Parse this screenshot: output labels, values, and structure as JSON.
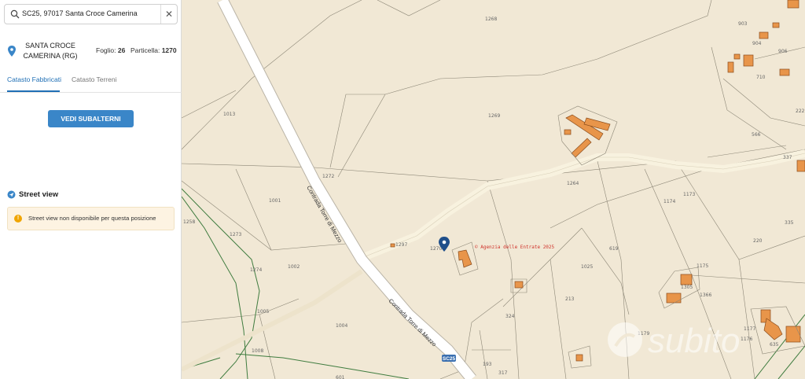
{
  "search": {
    "value": "SC25, 97017 Santa Croce Camerina",
    "search_icon": "search-icon",
    "clear_icon": "close-icon"
  },
  "location": {
    "town_line1": "SANTA CROCE",
    "town_line2": "CAMERINA (RG)",
    "foglio_label": "Foglio:",
    "foglio_value": "26",
    "particella_label": "Particella:",
    "particella_value": "1270"
  },
  "tabs": [
    {
      "label": "Catasto Fabbricati",
      "active": true
    },
    {
      "label": "Catasto Terreni",
      "active": false
    }
  ],
  "button": {
    "label": "VEDI SUBALTERNI"
  },
  "street_view": {
    "title": "Street view",
    "message": "Street view non disponibile per questa posizione"
  },
  "map": {
    "parcel_labels": [
      "1268",
      "903",
      "904",
      "906",
      "710",
      "1013",
      "1269",
      "566",
      "222",
      "1272",
      "1264",
      "337",
      "1001",
      "1173",
      "1174",
      "1258",
      "1273",
      "1297",
      "1270",
      "619",
      "220",
      "335",
      "1274",
      "1002",
      "1025",
      "1175",
      "1305",
      "1366",
      "213",
      "1005",
      "324",
      "1004",
      "1179",
      "1176",
      "1177",
      "635",
      "1008",
      "193",
      "317",
      "601"
    ],
    "road_names": [
      "Contrada Torre di Mezzo",
      "Contrada Torre di Mezzo"
    ],
    "road_shield": "SC25",
    "notice": "© Agenzia delle Entrate 2025",
    "watermark": "subito",
    "colors": {
      "background": "#f1e8d5",
      "building": "#e8954a",
      "road": "#ffffff",
      "accent": "#1f6fb5"
    }
  }
}
